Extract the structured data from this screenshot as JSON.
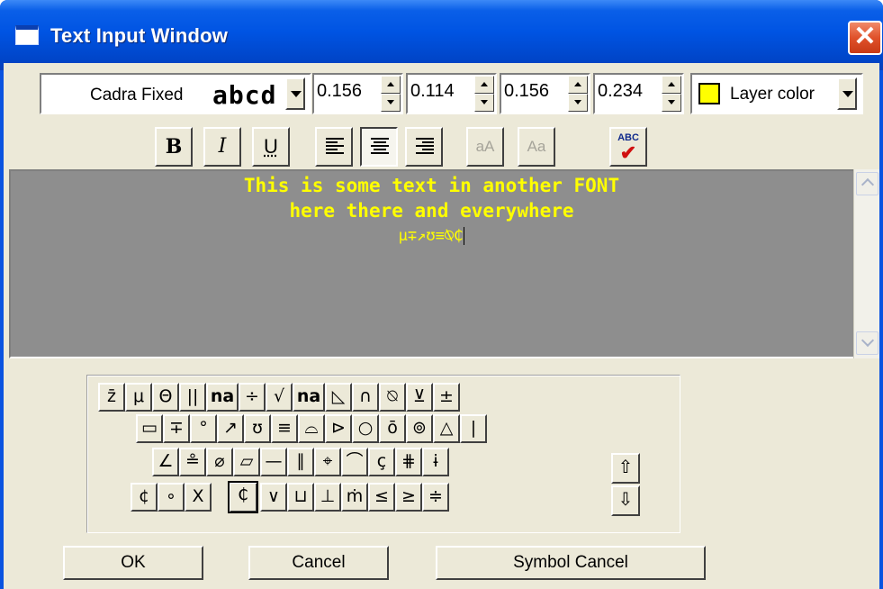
{
  "window": {
    "title": "Text Input Window"
  },
  "toolbar": {
    "font_name": "Cadra Fixed",
    "font_sample": "abcd",
    "spinners": [
      "0.156",
      "0.114",
      "0.156",
      "0.234"
    ],
    "color_label": "Layer color",
    "color_swatch": "#ffff00",
    "bold_label": "B",
    "italic_label": "I",
    "underline_label": "U",
    "shrink_label": "aA",
    "case_label": "Aa",
    "spellcheck_label": "ABC"
  },
  "editor": {
    "text_color": "#ffff00",
    "lines": [
      "This is some text in another FONT",
      "here there and everywhere",
      "μ∓↗ʊ≡⍉₵"
    ]
  },
  "symbols": {
    "row1": [
      "z̄",
      "μ",
      "Θ",
      "||",
      "na",
      "÷",
      "√",
      "na",
      "◺",
      "∩",
      "⍉",
      "⊻",
      "±"
    ],
    "row2": [
      "▭",
      "∓",
      "°",
      "↗",
      "ʊ",
      "≡",
      "⌓",
      "⊳",
      "○",
      "ō",
      "⊚",
      "△",
      "|"
    ],
    "row3": [
      "∠",
      "≗",
      "⌀",
      "▱",
      "—",
      "∥",
      "⌖",
      "⌒",
      "ç",
      "⋕",
      "ɨ"
    ],
    "row4": [
      "¢",
      "∘",
      "X",
      "₵",
      "∨",
      "⊔",
      "⊥",
      "ṁ",
      "≤",
      "≥",
      "≑"
    ],
    "scroll_up": "⇧",
    "scroll_down": "⇩"
  },
  "buttons": {
    "ok": "OK",
    "cancel": "Cancel",
    "symbol_cancel": "Symbol Cancel"
  }
}
